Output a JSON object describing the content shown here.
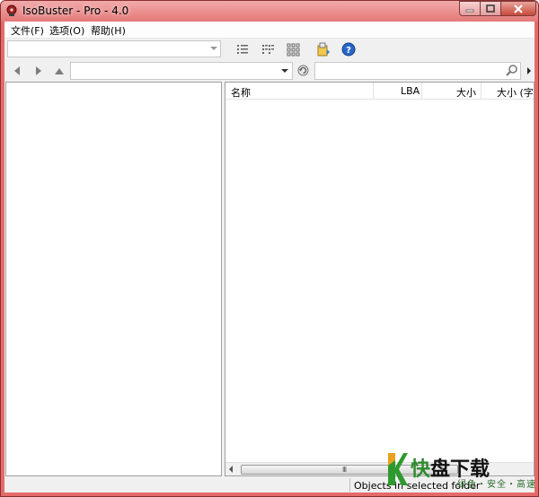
{
  "window": {
    "title": "IsoBuster - Pro - 4.0"
  },
  "menu": {
    "items": [
      "文件(F)",
      "选项(O)",
      "帮助(H)"
    ]
  },
  "toolbar": {
    "path_combo_value": "",
    "icons": [
      "details-view-icon",
      "list-view-icon",
      "grid-view-icon",
      "extract-icon",
      "help-icon"
    ]
  },
  "navbar": {
    "address_value": "",
    "search_value": "",
    "icons": [
      "back-icon",
      "forward-icon",
      "up-icon",
      "refresh-icon",
      "search-icon"
    ]
  },
  "list": {
    "columns": [
      "名称",
      "LBA",
      "大小",
      "大小 (字节"
    ],
    "scroll_grip": "III"
  },
  "status": {
    "text": "Objects in selected folder"
  },
  "watermark": {
    "brand_first": "快",
    "brand_rest": "盘下载",
    "tagline": "绿色・安全・高速"
  },
  "colors": {
    "titlebar": "#e47878",
    "frame": "#e56a6a",
    "client": "#f0f0f0",
    "watermark_green": "#2d8a2d"
  }
}
